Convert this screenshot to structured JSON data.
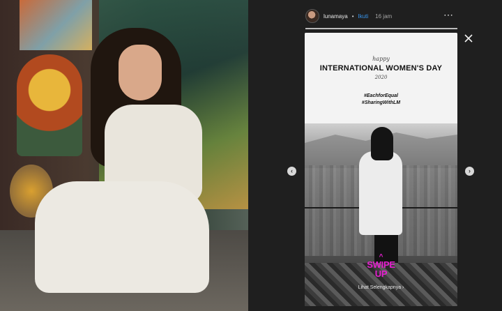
{
  "post": {
    "username": "lunamaya",
    "separator": "•",
    "follow_label": "Ikuti",
    "time": "16 jam",
    "more_icon": "⋯"
  },
  "story": {
    "happy": "happy",
    "title": "INTERNATIONAL WOMEN'S DAY",
    "year": "2020",
    "hashtags": [
      "#EachforEqual",
      "#SharingWithLM"
    ],
    "swipe_chevron": "^",
    "swipe_label_line1": "SWIPE",
    "swipe_label_line2": "UP",
    "see_more": "Lihat Selengkapnya",
    "see_more_chevron": "›"
  },
  "nav": {
    "prev": "‹",
    "next": "›"
  },
  "icons": {
    "close": "close-icon",
    "more": "more-options-icon",
    "prev": "chevron-left-icon",
    "next": "chevron-right-icon"
  },
  "colors": {
    "background": "#1f1f1f",
    "follow": "#3897f0",
    "swipe_up": "#e61fd0"
  }
}
